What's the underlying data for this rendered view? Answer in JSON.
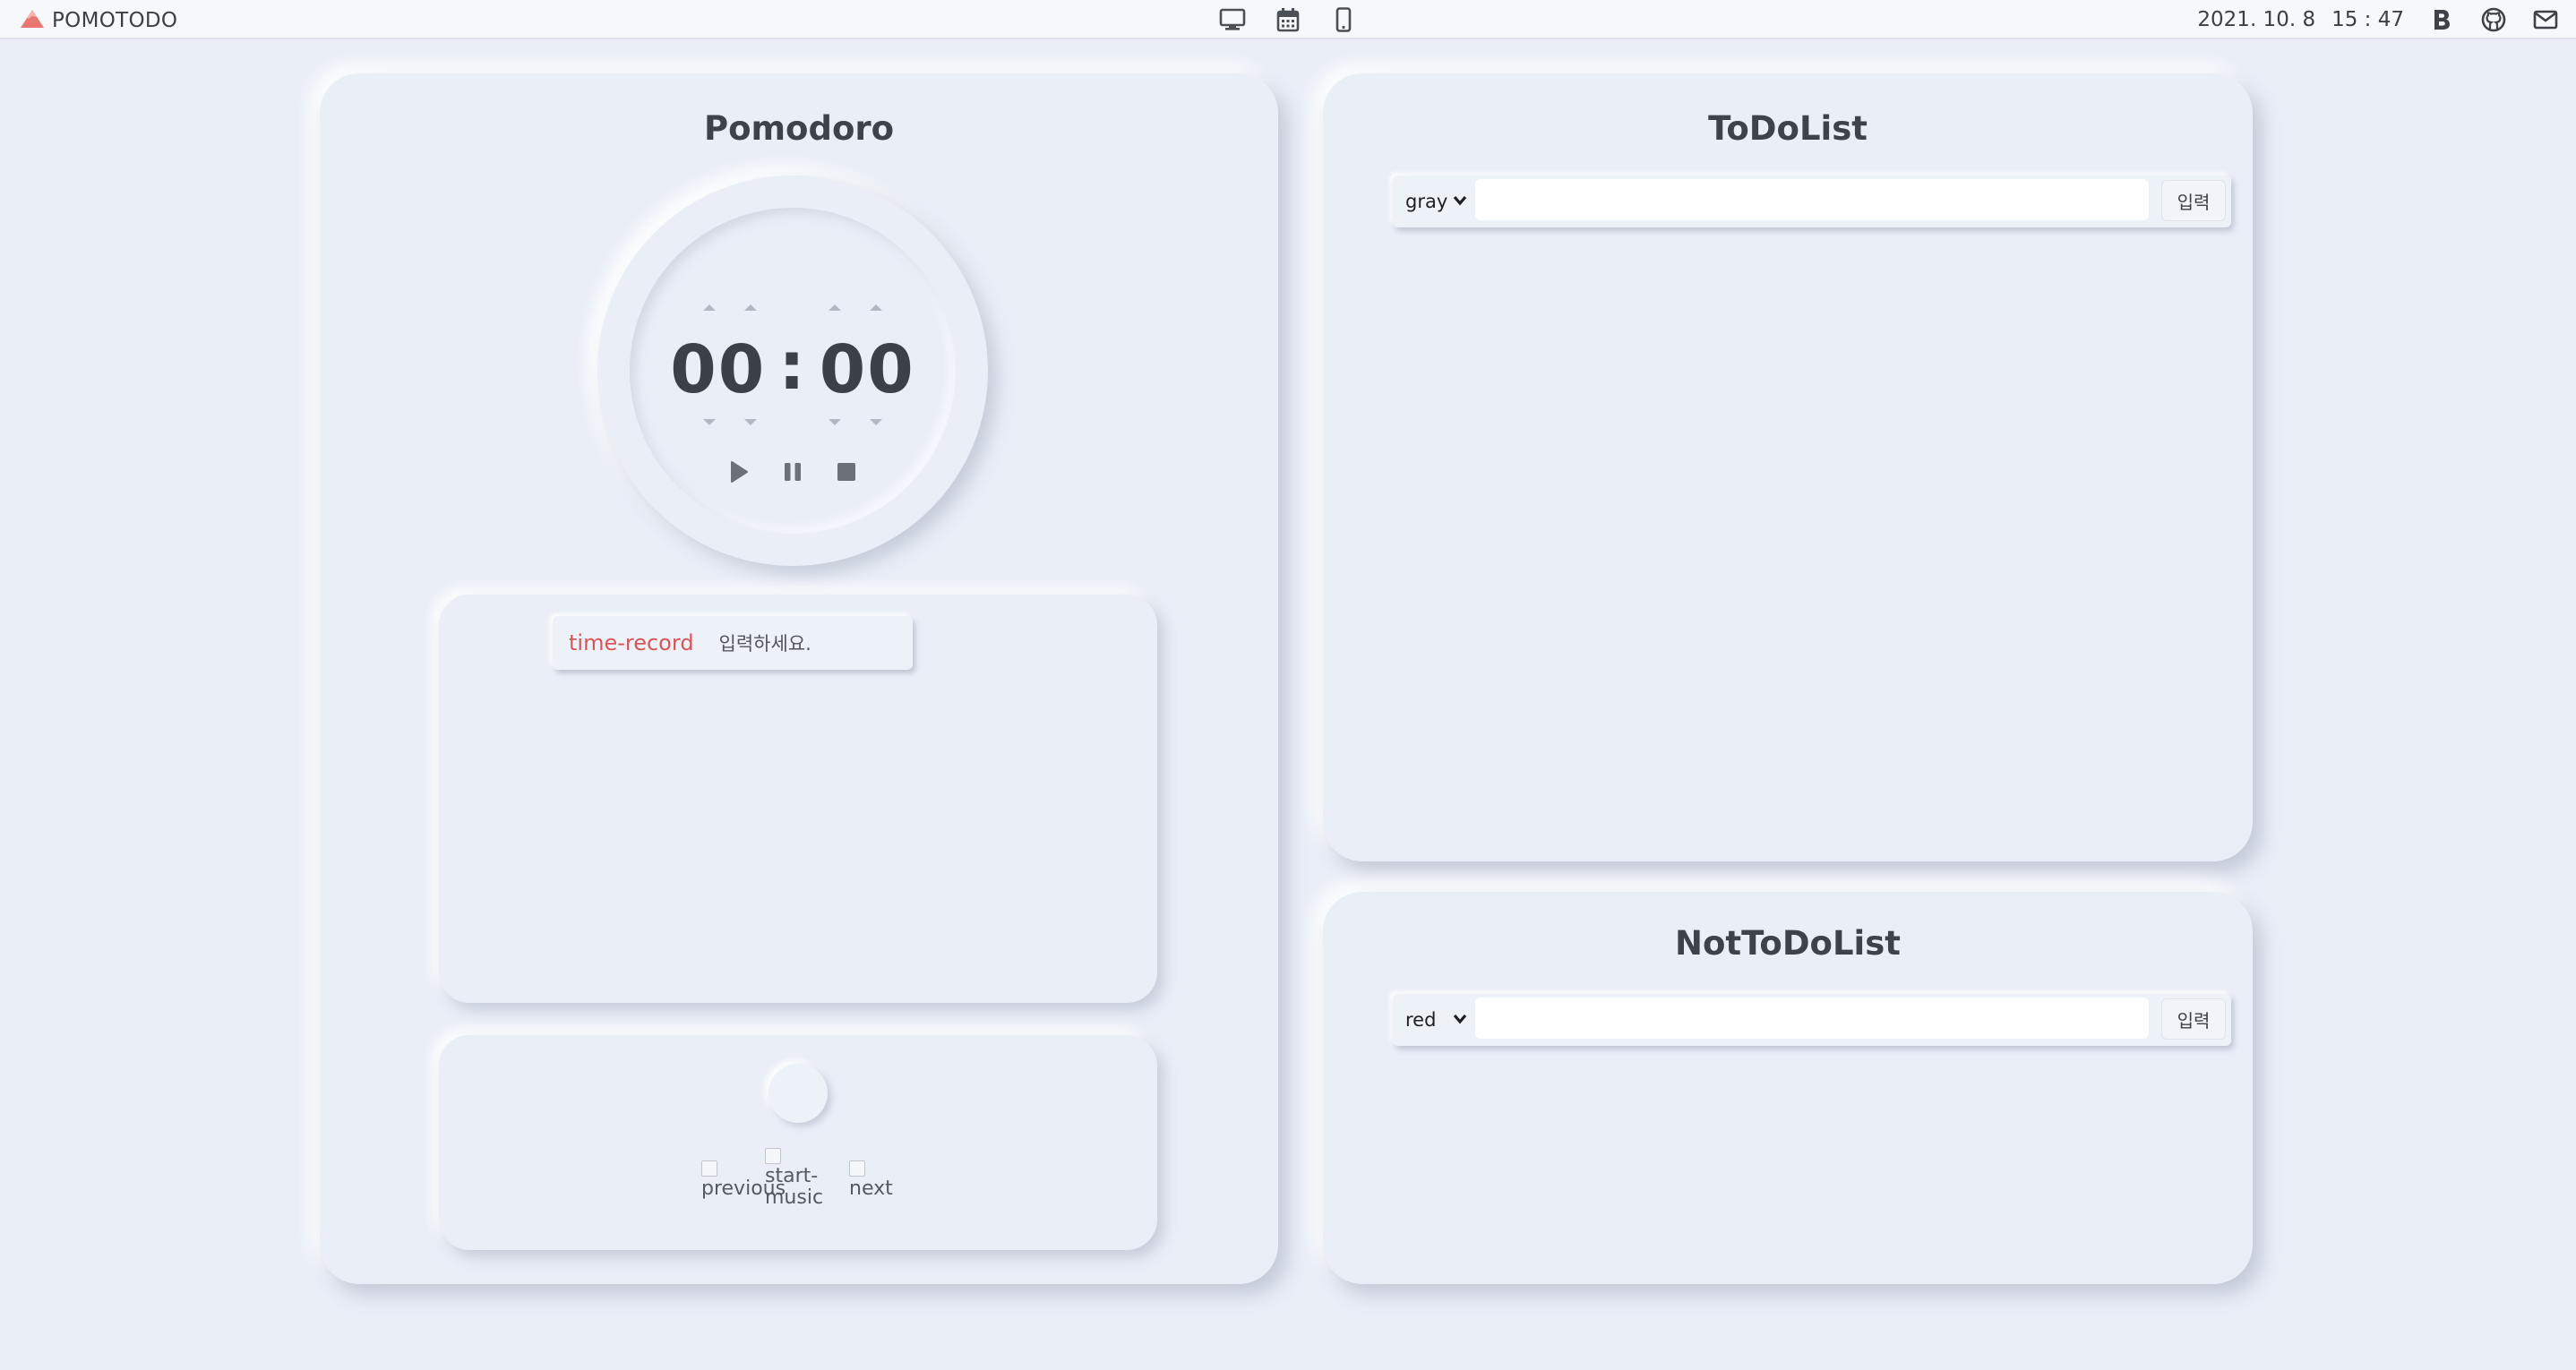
{
  "app": {
    "brand": "POMOTODO",
    "date": "2021. 10. 8",
    "time": "15 : 47",
    "accent_color": "#e9776f"
  },
  "header": {
    "mode_icons": [
      "desktop-icon",
      "calendar-icon",
      "mobile-icon"
    ],
    "right_icons": [
      "blog-b-icon",
      "github-icon",
      "mail-icon"
    ]
  },
  "pomodoro": {
    "title": "Pomodoro",
    "minutes": "00",
    "separator": ":",
    "seconds": "00",
    "controls": [
      "play-icon",
      "pause-icon",
      "stop-icon"
    ],
    "record": {
      "label": "time-record",
      "placeholder": "입력하세요.",
      "label_color": "#d7565a"
    },
    "music": {
      "previous_alt": "previous",
      "start_alt": "start-music",
      "next_alt": "next"
    }
  },
  "todo": {
    "title": "ToDoList",
    "selected_color": "gray",
    "input_value": "",
    "submit_label": "입력"
  },
  "nottodo": {
    "title": "NotToDoList",
    "selected_color": "red",
    "input_value": "",
    "submit_label": "입력"
  }
}
